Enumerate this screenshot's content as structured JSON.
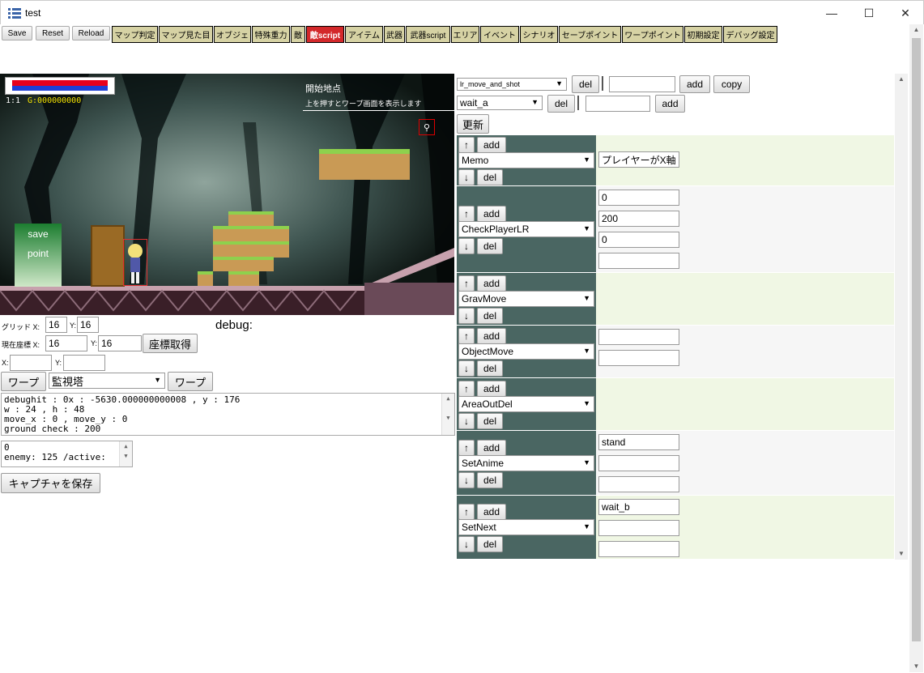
{
  "window": {
    "title": "test",
    "minimize": "—",
    "maximize": "☐",
    "close": "✕"
  },
  "toolbar": {
    "save": "Save",
    "reset": "Reset",
    "reload": "Reload",
    "tabs": [
      "マップ判定",
      "マップ見た目",
      "オブジェ",
      "特殊重力",
      "敵",
      "敵script",
      "アイテム",
      "武器",
      "武器script",
      "エリア",
      "イベント",
      "シナリオ",
      "セーブポイント",
      "ワープポイント",
      "初期設定",
      "デバッグ設定"
    ],
    "active_tab": "敵script"
  },
  "game": {
    "level": "1:1",
    "gold": "G:000000000",
    "place_name": "開始地点",
    "place_desc": "上を押すとワープ画面を表示します",
    "save_label_1": "save",
    "save_label_2": "point",
    "hp_color": "#e8001c",
    "mp_color": "#1f3fd6"
  },
  "grid": {
    "label": "グリッド X:",
    "x": "16",
    "ylabel": "Y:",
    "y": "16"
  },
  "coords": {
    "label": "現在座標 X:",
    "x": "16",
    "ylabel": "Y:",
    "y": "16",
    "get_button": "座標取得"
  },
  "warp_xy": {
    "xlabel": "X:",
    "ylabel": "Y:"
  },
  "warp": {
    "button_left": "ワープ",
    "target": "監視塔",
    "button_right": "ワープ"
  },
  "debug_label": "debug:",
  "debug_log": [
    "debughit : 0x : -5630.000000000008 , y : 176",
    "w : 24 , h : 48",
    "move_x : 0 , move_y : 0",
    "ground check : 200"
  ],
  "enemy_log": [
    "0",
    "enemy: 125 /active:"
  ],
  "capture_button": "キャプチャを保存",
  "script": {
    "script_select": "lr_move_and_shot",
    "del1": "del",
    "add1": "add",
    "copy": "copy",
    "state_select": "wait_a",
    "del2": "del",
    "add2": "add",
    "update": "更新"
  },
  "cmd_rows": [
    {
      "up": "↑",
      "add": "add",
      "cmd": "Memo",
      "down": "↓",
      "del": "del",
      "params": [
        "プレイヤーがX軸"
      ]
    },
    {
      "up": "↑",
      "add": "add",
      "cmd": "CheckPlayerLR",
      "down": "↓",
      "del": "del",
      "params": [
        "0",
        "200",
        "0",
        ""
      ]
    },
    {
      "up": "↑",
      "add": "add",
      "cmd": "GravMove",
      "down": "↓",
      "del": "del",
      "params": []
    },
    {
      "up": "↑",
      "add": "add",
      "cmd": "ObjectMove",
      "down": "↓",
      "del": "del",
      "params": [
        "",
        ""
      ]
    },
    {
      "up": "↑",
      "add": "add",
      "cmd": "AreaOutDel",
      "down": "↓",
      "del": "del",
      "params": []
    },
    {
      "up": "↑",
      "add": "add",
      "cmd": "SetAnime",
      "down": "↓",
      "del": "del",
      "params": [
        "stand",
        "",
        ""
      ]
    },
    {
      "up": "↑",
      "add": "add",
      "cmd": "SetNext",
      "down": "↓",
      "del": "del",
      "params": [
        "wait_b",
        "",
        ""
      ]
    }
  ]
}
